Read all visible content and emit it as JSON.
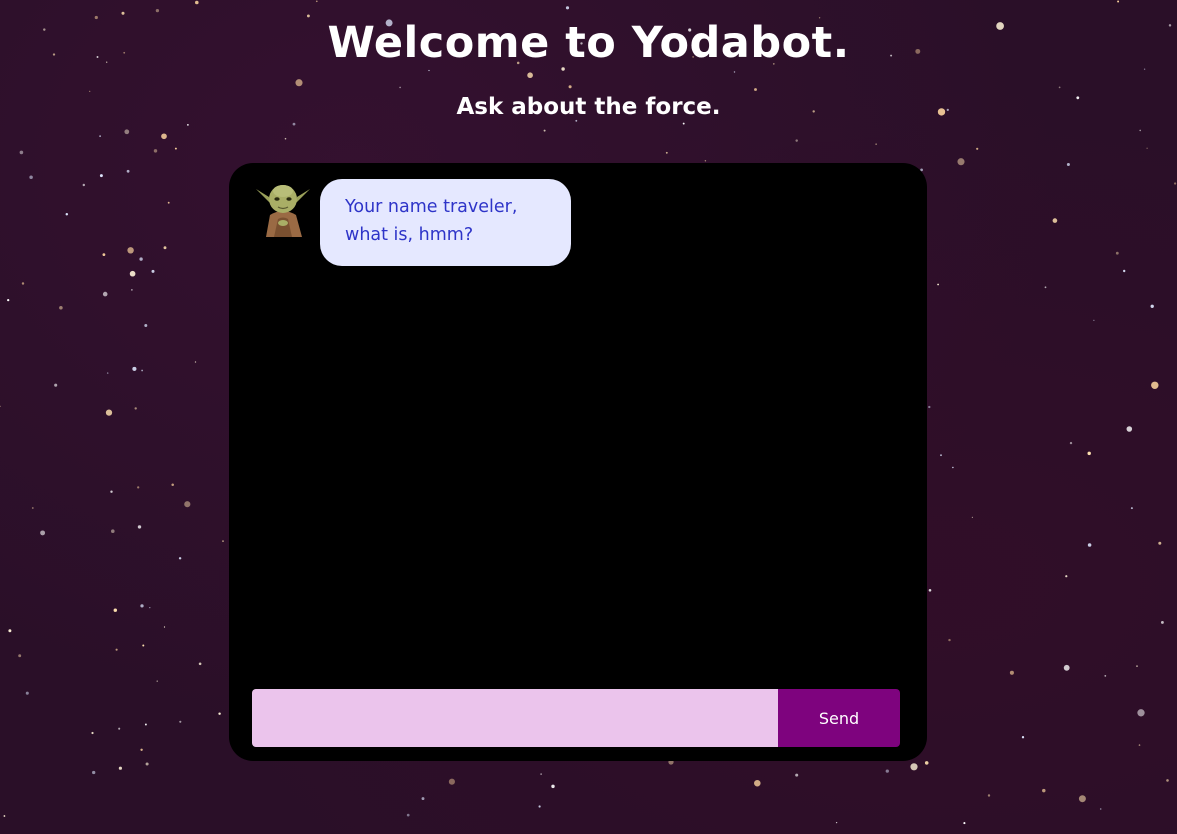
{
  "header": {
    "title": "Welcome to Yodabot.",
    "subtitle": "Ask about the force."
  },
  "chat": {
    "messages": [
      {
        "sender": "bot",
        "avatar_icon": "yoda-avatar-icon",
        "text": "Your name traveler, what is, hmm?"
      }
    ],
    "input": {
      "value": "",
      "placeholder": ""
    },
    "send_label": "Send"
  },
  "colors": {
    "background": "#2a0f28",
    "chat_window": "#000000",
    "bubble_bg": "#e5e8ff",
    "bubble_text": "#2e34c8",
    "input_bg": "#ebc4ec",
    "send_button": "#7e037e"
  }
}
